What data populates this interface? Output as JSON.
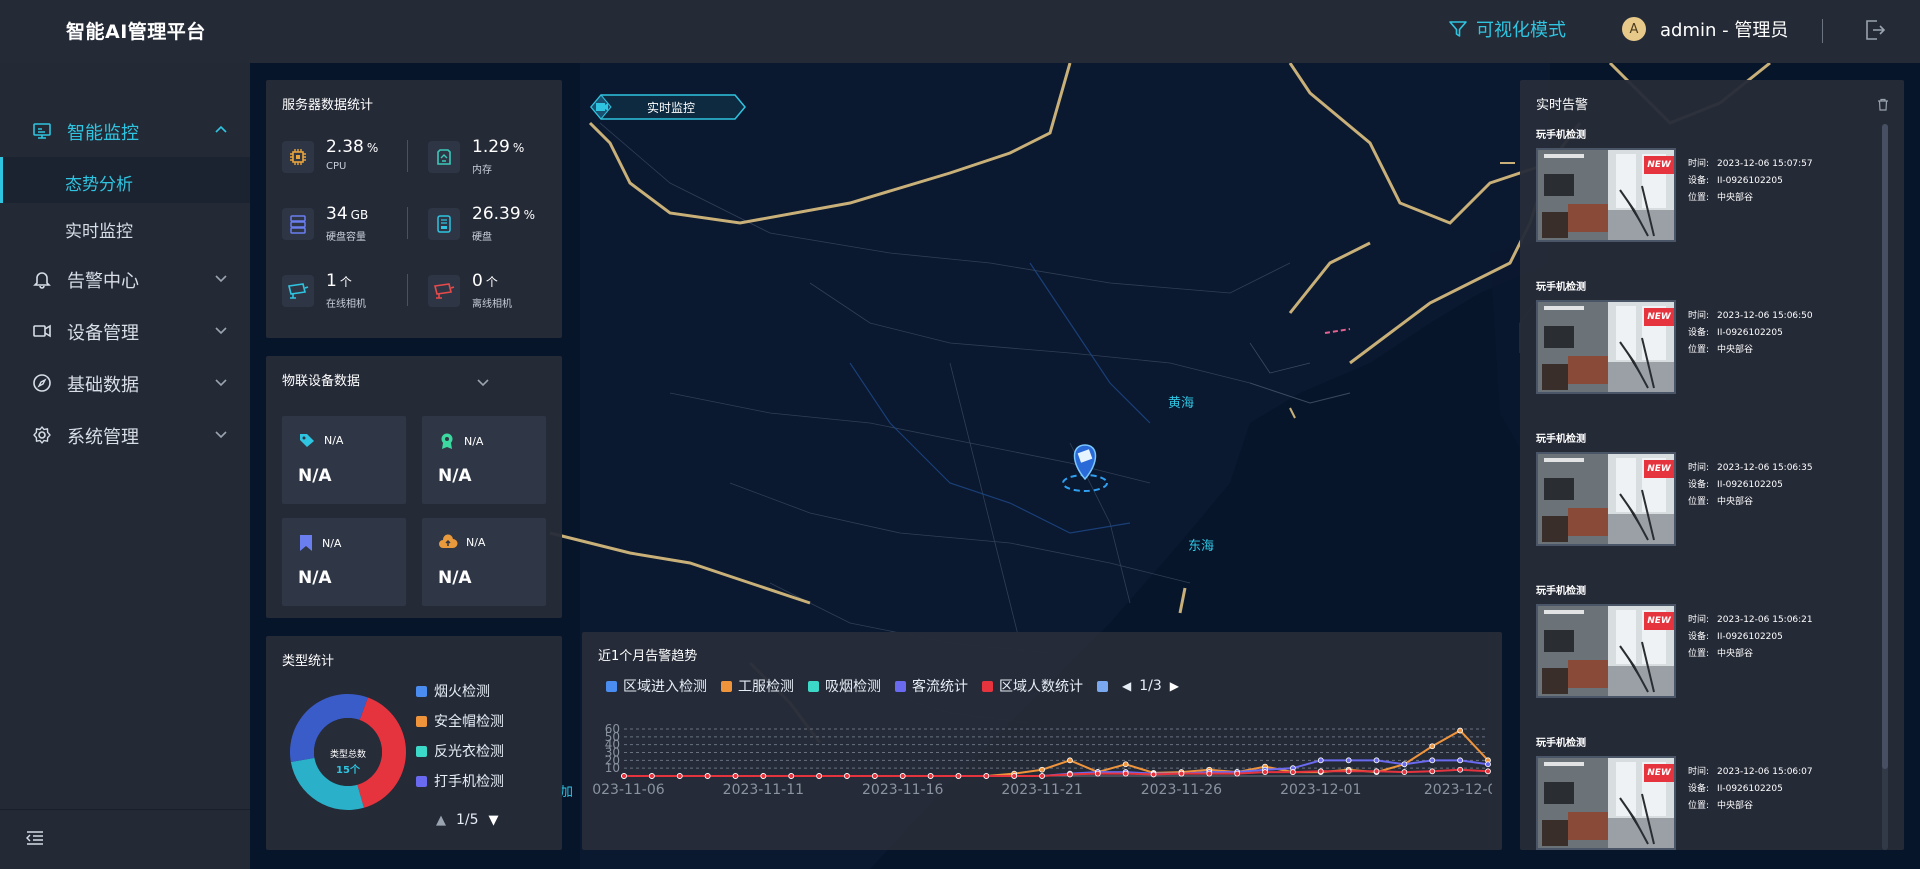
{
  "header": {
    "title": "智能AI管理平台",
    "mode_label": "可视化模式",
    "avatar_letter": "A",
    "user_label": "admin - 管理员"
  },
  "sidebar": {
    "items": [
      {
        "label": "智能监控",
        "icon": "monitor-icon",
        "expanded": true
      },
      {
        "label": "告警中心",
        "icon": "bell-icon"
      },
      {
        "label": "设备管理",
        "icon": "camera-device-icon"
      },
      {
        "label": "基础数据",
        "icon": "compass-icon"
      },
      {
        "label": "系统管理",
        "icon": "gear-icon"
      }
    ],
    "subitems": [
      {
        "label": "态势分析",
        "selected": true
      },
      {
        "label": "实时监控"
      }
    ]
  },
  "map": {
    "tag_label": "实时监控",
    "labels": {
      "sea1": "黄海",
      "sea2": "东海",
      "edge": "加"
    }
  },
  "server_stats": {
    "title": "服务器数据统计",
    "items": [
      {
        "value": "2.38",
        "unit": "%",
        "label": "CPU",
        "icon": "cpu-icon",
        "color": "#e8a43c"
      },
      {
        "value": "1.29",
        "unit": "%",
        "label": "内存",
        "icon": "memory-icon",
        "color": "#3cc8b8"
      },
      {
        "value": "34",
        "unit": "GB",
        "label": "硬盘容量",
        "icon": "server-icon",
        "color": "#6a7ef0"
      },
      {
        "value": "26.39",
        "unit": "%",
        "label": "硬盘",
        "icon": "disk-icon",
        "color": "#2fc4e0"
      },
      {
        "value": "1",
        "unit": "个",
        "label": "在线相机",
        "icon": "camera-online-icon",
        "color": "#2fc4e0"
      },
      {
        "value": "0",
        "unit": "个",
        "label": "离线相机",
        "icon": "camera-offline-icon",
        "color": "#e84a4a"
      }
    ]
  },
  "iot": {
    "title": "物联设备数据",
    "cards": [
      {
        "name": "N/A",
        "value": "N/A",
        "icon": "tag-icon",
        "color": "#2fc4e0"
      },
      {
        "name": "N/A",
        "value": "N/A",
        "icon": "badge-icon",
        "color": "#3cd8a0"
      },
      {
        "name": "N/A",
        "value": "N/A",
        "icon": "bookmark-icon",
        "color": "#6a7ef0"
      },
      {
        "name": "N/A",
        "value": "N/A",
        "icon": "cloud-upload-icon",
        "color": "#e89a3c"
      }
    ]
  },
  "type_stats": {
    "title": "类型统计",
    "center_title": "类型总数",
    "center_value": "15个",
    "legend": [
      {
        "label": "烟火检测",
        "color": "#4a8cf0"
      },
      {
        "label": "安全帽检测",
        "color": "#f0943c"
      },
      {
        "label": "反光衣检测",
        "color": "#3cd8c8"
      },
      {
        "label": "打手机检测",
        "color": "#6a6af0"
      }
    ],
    "donut": [
      {
        "value": 6,
        "color": "#e6343f"
      },
      {
        "value": 4,
        "color": "#2ab0c8"
      },
      {
        "value": 5,
        "color": "#3a5cc8"
      }
    ],
    "pager": "1/5"
  },
  "chart_data": {
    "type": "line",
    "title": "近1个月告警趋势",
    "legend": [
      {
        "label": "区域进入检测",
        "color": "#4a8cf0"
      },
      {
        "label": "工服检测",
        "color": "#f0943c"
      },
      {
        "label": "吸烟检测",
        "color": "#3cd8c8"
      },
      {
        "label": "客流统计",
        "color": "#6a6af0"
      },
      {
        "label": "区域人数统计",
        "color": "#e6343f"
      }
    ],
    "legend_pager": "1/3",
    "y_ticks": [
      "60",
      "50",
      "40",
      "30",
      "20",
      "10"
    ],
    "ylim": [
      0,
      60
    ],
    "x_labels": [
      "2023-11-06",
      "2023-11-11",
      "2023-11-16",
      "2023-11-21",
      "2023-11-26",
      "2023-12-01",
      "2023-12-0"
    ],
    "x": [
      "2023-11-06",
      "2023-11-07",
      "2023-11-08",
      "2023-11-09",
      "2023-11-10",
      "2023-11-11",
      "2023-11-12",
      "2023-11-13",
      "2023-11-14",
      "2023-11-15",
      "2023-11-16",
      "2023-11-17",
      "2023-11-18",
      "2023-11-19",
      "2023-11-20",
      "2023-11-21",
      "2023-11-22",
      "2023-11-23",
      "2023-11-24",
      "2023-11-25",
      "2023-11-26",
      "2023-11-27",
      "2023-11-28",
      "2023-11-29",
      "2023-11-30",
      "2023-12-01",
      "2023-12-02",
      "2023-12-03",
      "2023-12-04",
      "2023-12-05",
      "2023-12-06",
      "2023-12-07"
    ],
    "series": [
      {
        "color": "#f0943c",
        "values": [
          0,
          0,
          0,
          0,
          0,
          0,
          0,
          0,
          0,
          0,
          0,
          0,
          0,
          0,
          3,
          8,
          20,
          5,
          15,
          4,
          5,
          8,
          5,
          12,
          5,
          5,
          8,
          5,
          15,
          38,
          58,
          20
        ]
      },
      {
        "color": "#6a6af0",
        "values": [
          0,
          0,
          0,
          0,
          0,
          0,
          0,
          0,
          0,
          0,
          0,
          0,
          0,
          0,
          0,
          0,
          3,
          5,
          5,
          3,
          3,
          5,
          5,
          8,
          10,
          20,
          20,
          20,
          15,
          20,
          20,
          15
        ]
      },
      {
        "color": "#e6343f",
        "values": [
          0,
          0,
          0,
          0,
          0,
          0,
          0,
          0,
          0,
          0,
          0,
          0,
          0,
          0,
          0,
          0,
          2,
          3,
          3,
          2,
          3,
          3,
          3,
          5,
          5,
          6,
          6,
          6,
          5,
          6,
          8,
          6
        ]
      }
    ]
  },
  "alerts": {
    "title": "实时告警",
    "new_tag": "NEW",
    "key_time": "时间:",
    "key_device": "设备:",
    "key_location": "位置:",
    "items": [
      {
        "title": "玩手机检测",
        "time": "2023-12-06 15:07:57",
        "device": "II-0926102205",
        "location": "中央部谷"
      },
      {
        "title": "玩手机检测",
        "time": "2023-12-06 15:06:50",
        "device": "II-0926102205",
        "location": "中央部谷"
      },
      {
        "title": "玩手机检测",
        "time": "2023-12-06 15:06:35",
        "device": "II-0926102205",
        "location": "中央部谷"
      },
      {
        "title": "玩手机检测",
        "time": "2023-12-06 15:06:21",
        "device": "II-0926102205",
        "location": "中央部谷"
      },
      {
        "title": "玩手机检测",
        "time": "2023-12-06 15:06:07",
        "device": "II-0926102205",
        "location": "中央部谷"
      }
    ]
  },
  "colors": {
    "accent": "#2fc4e0",
    "panel": "#262c38",
    "map_bg": "#07152b",
    "border_gold": "#c8b078"
  }
}
